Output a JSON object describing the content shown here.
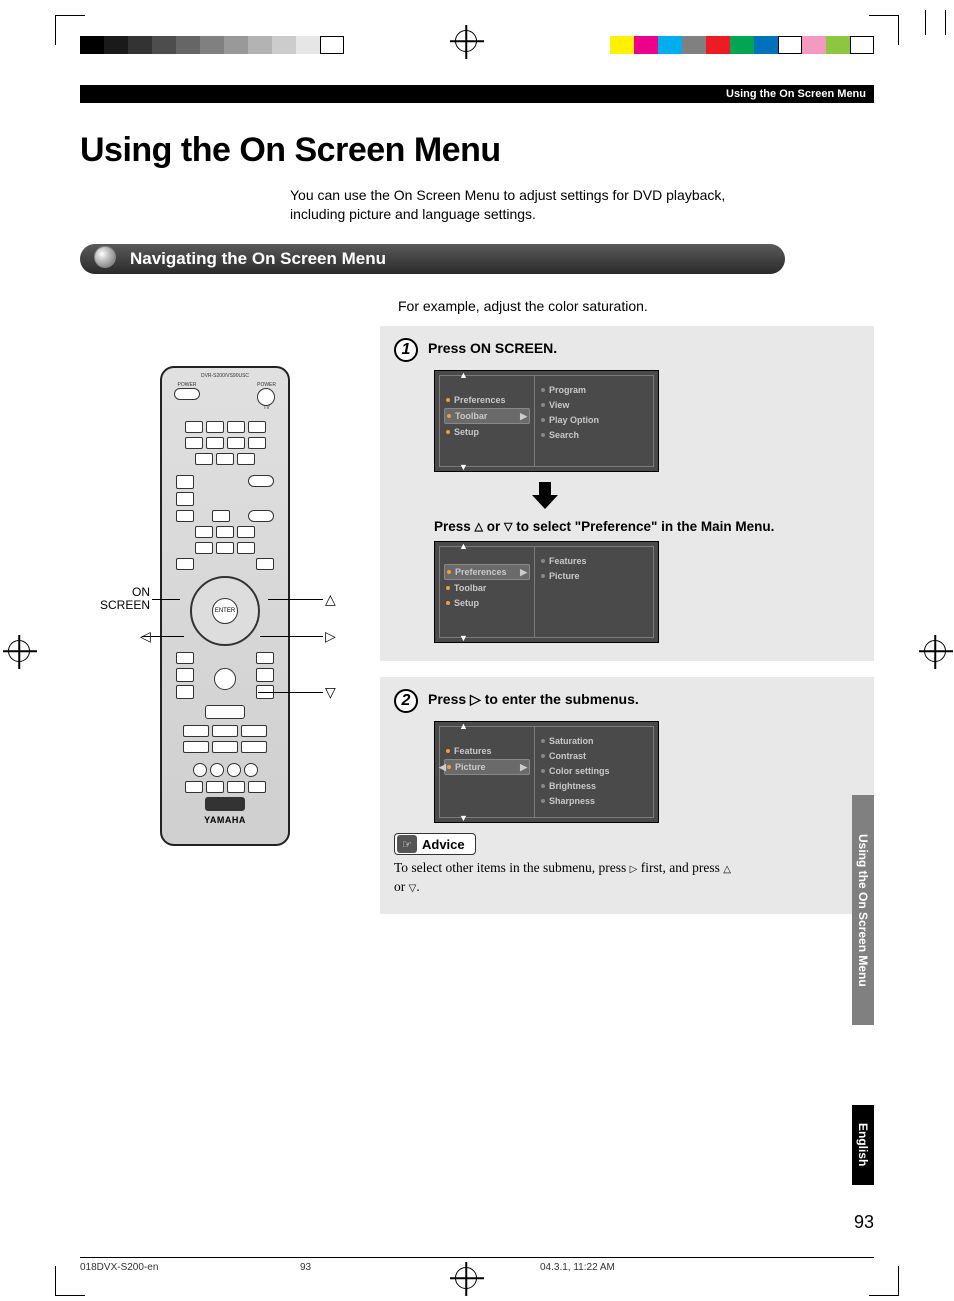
{
  "header_bar": "Using the On Screen Menu",
  "page_title": "Using the On Screen Menu",
  "intro": "You can use the On Screen Menu to adjust settings for DVD playback, including picture and language settings.",
  "section_heading": "Navigating the On Screen Menu",
  "example_line": "For example, adjust the color saturation.",
  "remote_labels": {
    "on_screen": "ON SCREEN",
    "enter": "ENTER",
    "brand": "YAMAHA",
    "model": "DVR-S200/VS90USC",
    "power_l": "POWER",
    "power_r": "POWER",
    "tv": "TV"
  },
  "step1": {
    "num": "1",
    "title": "Press ON SCREEN.",
    "osd1_left": [
      "Preferences",
      "Toolbar",
      "Setup"
    ],
    "osd1_left_hl_index": 1,
    "osd1_right": [
      "Program",
      "View",
      "Play Option",
      "Search"
    ],
    "sub_instruction_pre": "Press ",
    "sub_instruction_mid": " or ",
    "sub_instruction_post": " to select \"Preference\" in the Main Menu.",
    "osd2_left": [
      "Preferences",
      "Toolbar",
      "Setup"
    ],
    "osd2_left_hl_index": 0,
    "osd2_right": [
      "Features",
      "Picture"
    ]
  },
  "step2": {
    "num": "2",
    "title_pre": "Press ",
    "title_post": " to enter the submenus.",
    "osd_left": [
      "Features",
      "Picture"
    ],
    "osd_left_hl_index": 1,
    "osd_right": [
      "Saturation",
      "Contrast",
      "Color settings",
      "Brightness",
      "Sharpness"
    ],
    "advice_label": "Advice",
    "advice_pre": "To select other items in the submenu, press ",
    "advice_mid": " first, and press ",
    "advice_or": " or ",
    "advice_end": "."
  },
  "side_tab_section": "Using the On Screen Menu",
  "side_tab_lang": "English",
  "page_number": "93",
  "footer": {
    "doc": "018DVX-S200-en",
    "page": "93",
    "timestamp": "04.3.1, 11:22 AM"
  },
  "colors": {
    "strip_left": [
      "#000",
      "#1a1a1a",
      "#333",
      "#4d4d4d",
      "#666",
      "#808080",
      "#999",
      "#b3b3b3",
      "#ccc",
      "#e6e6e6",
      "#fff"
    ],
    "strip_right": [
      "#fff200",
      "#ec008c",
      "#00aeef",
      "#808080",
      "#ed1c24",
      "#00a651",
      "#0072bc",
      "#fff",
      "#f49ac1",
      "#8dc63f",
      "#fff"
    ]
  }
}
